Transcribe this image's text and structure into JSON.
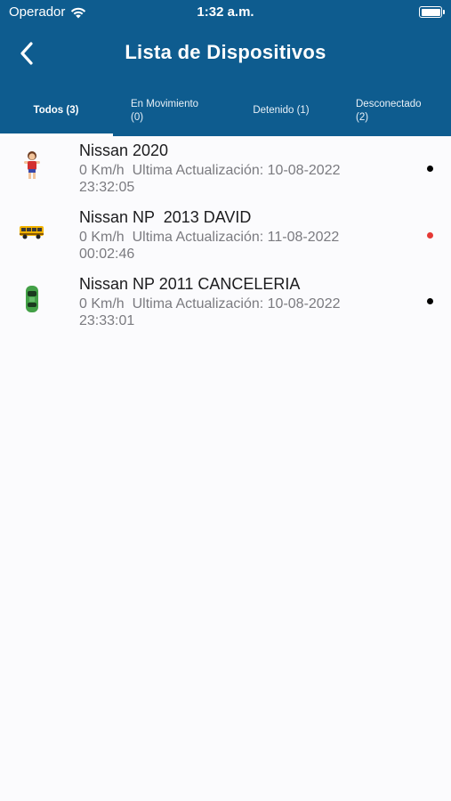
{
  "status_bar": {
    "carrier": "Operador",
    "time": "1:32 a.m."
  },
  "header": {
    "title": "Lista de Dispositivos",
    "back_icon": "chevron-left-icon"
  },
  "tabs": [
    {
      "label": "Todos (3)",
      "active": true
    },
    {
      "label": "En Movimiento\n(0)",
      "active": false
    },
    {
      "label": "Detenido (1)",
      "active": false
    },
    {
      "label": "Desconectado\n(2)",
      "active": false
    }
  ],
  "devices": [
    {
      "name": "Nissan 2020",
      "info": "0 Km/h  Ultima Actualización: 10-08-2022\n23:32:05",
      "icon": "person-icon",
      "status_color": "#000000"
    },
    {
      "name": "Nissan NP  2013 DAVID",
      "info": "0 Km/h  Ultima Actualización: 11-08-2022\n00:02:46",
      "icon": "bus-icon",
      "status_color": "#e53935"
    },
    {
      "name": "Nissan NP 2011 CANCELERIA",
      "info": "0 Km/h  Ultima Actualización: 10-08-2022\n23:33:01",
      "icon": "green-car-icon",
      "status_color": "#000000"
    }
  ],
  "colors": {
    "header_bg": "#0e5c8f",
    "page_bg": "#fbfbfd",
    "online_dot": "#000000",
    "offline_dot": "#e53935"
  }
}
